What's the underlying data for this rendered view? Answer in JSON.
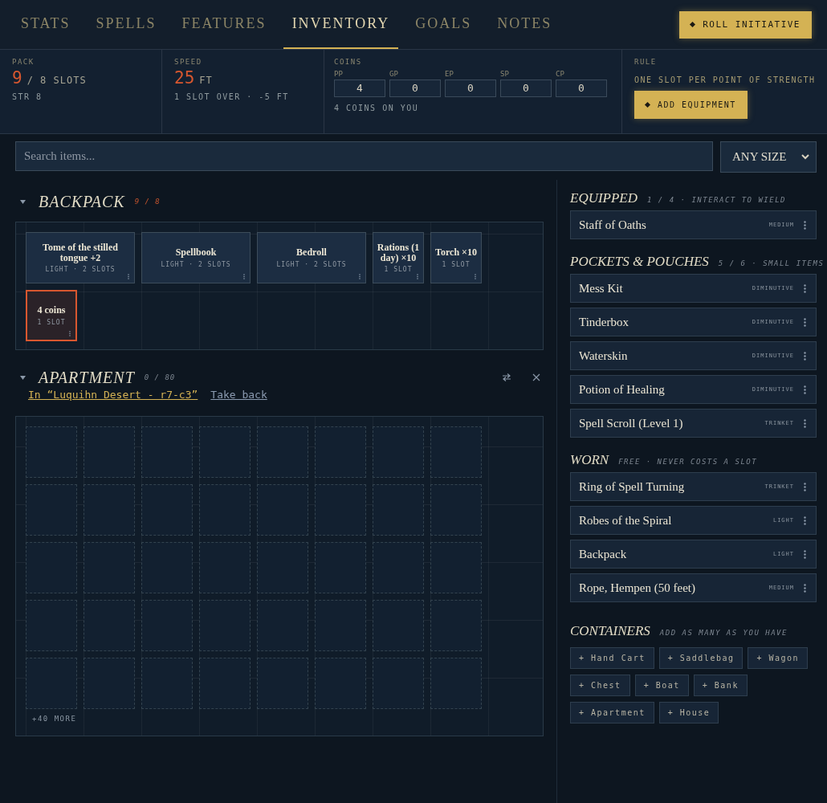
{
  "tabs": [
    {
      "label": "STATS",
      "selected": false
    },
    {
      "label": "SPELLS",
      "selected": false
    },
    {
      "label": "FEATURES",
      "selected": false
    },
    {
      "label": "INVENTORY",
      "selected": true
    },
    {
      "label": "GOALS",
      "selected": false
    },
    {
      "label": "NOTES",
      "selected": false
    }
  ],
  "roll_button": "ROLL INITIATIVE",
  "pack": {
    "label": "PACK",
    "value": "9",
    "unit": "/ 8 SLOTS",
    "sub": "STR 8",
    "over": true
  },
  "speed": {
    "label": "SPEED",
    "value": "25",
    "unit": "FT",
    "sub": "1 SLOT OVER · -5 FT",
    "over": true
  },
  "coins": {
    "label": "COINS",
    "note": "4 COINS ON YOU",
    "items": [
      {
        "label": "PP",
        "value": "4"
      },
      {
        "label": "GP",
        "value": "0"
      },
      {
        "label": "EP",
        "value": "0"
      },
      {
        "label": "SP",
        "value": "0"
      },
      {
        "label": "CP",
        "value": "0"
      }
    ]
  },
  "rule": {
    "label": "RULE",
    "text": "ONE SLOT PER POINT OF STRENGTH",
    "button": "ADD EQUIPMENT"
  },
  "search": {
    "placeholder": "Search items..."
  },
  "size_filter": "ANY SIZE",
  "backpack": {
    "title": "BACKPACK",
    "count": "9 / 8",
    "expanded": true,
    "items": [
      {
        "name": "Tome of the stilled tongue +2",
        "meta": "LIGHT · 2 SLOTS",
        "kind": "double",
        "overflow": false
      },
      {
        "name": "Spellbook",
        "meta": "LIGHT · 2 SLOTS",
        "kind": "double",
        "overflow": false
      },
      {
        "name": "Bedroll",
        "meta": "LIGHT · 2 SLOTS",
        "kind": "double",
        "overflow": false
      },
      {
        "name": "Rations (1 day) ×10",
        "meta": "1 SLOT",
        "kind": "single",
        "overflow": false
      },
      {
        "name": "Torch ×10",
        "meta": "1 SLOT",
        "kind": "single",
        "overflow": false
      },
      {
        "name": "4 coins",
        "meta": "1 SLOT",
        "kind": "single",
        "overflow": true
      }
    ]
  },
  "apartment": {
    "title": "APARTMENT",
    "count": "0 / 80",
    "expanded": true,
    "location": "In “Luquihn Desert - r7-c3”",
    "take_back": "Take back",
    "more": "+40 MORE"
  },
  "sections": [
    {
      "title": "EQUIPPED",
      "meta": "1 / 4 · INTERACT TO WIELD",
      "items": [
        {
          "name": "Staff of Oaths",
          "size": "MEDIUM"
        }
      ]
    },
    {
      "title": "POCKETS & POUCHES",
      "meta": "5 / 6 · SMALL ITEMS",
      "items": [
        {
          "name": "Mess Kit",
          "size": "DIMINUTIVE"
        },
        {
          "name": "Tinderbox",
          "size": "DIMINUTIVE"
        },
        {
          "name": "Waterskin",
          "size": "DIMINUTIVE"
        },
        {
          "name": "Potion of Healing",
          "size": "DIMINUTIVE"
        },
        {
          "name": "Spell Scroll (Level 1)",
          "size": "TRINKET"
        }
      ]
    },
    {
      "title": "WORN",
      "meta": "FREE · NEVER COSTS A SLOT",
      "items": [
        {
          "name": "Ring of Spell Turning",
          "size": "TRINKET"
        },
        {
          "name": "Robes of the Spiral",
          "size": "LIGHT"
        },
        {
          "name": "Backpack",
          "size": "LIGHT"
        },
        {
          "name": "Rope, Hempen (50 feet)",
          "size": "MEDIUM"
        }
      ]
    }
  ],
  "containers": {
    "title": "CONTAINERS",
    "meta": "ADD AS MANY AS YOU HAVE",
    "items": [
      "+ Hand Cart",
      "+ Saddlebag",
      "+ Wagon",
      "+ Chest",
      "+ Boat",
      "+ Bank",
      "+ Apartment",
      "+ House"
    ]
  }
}
